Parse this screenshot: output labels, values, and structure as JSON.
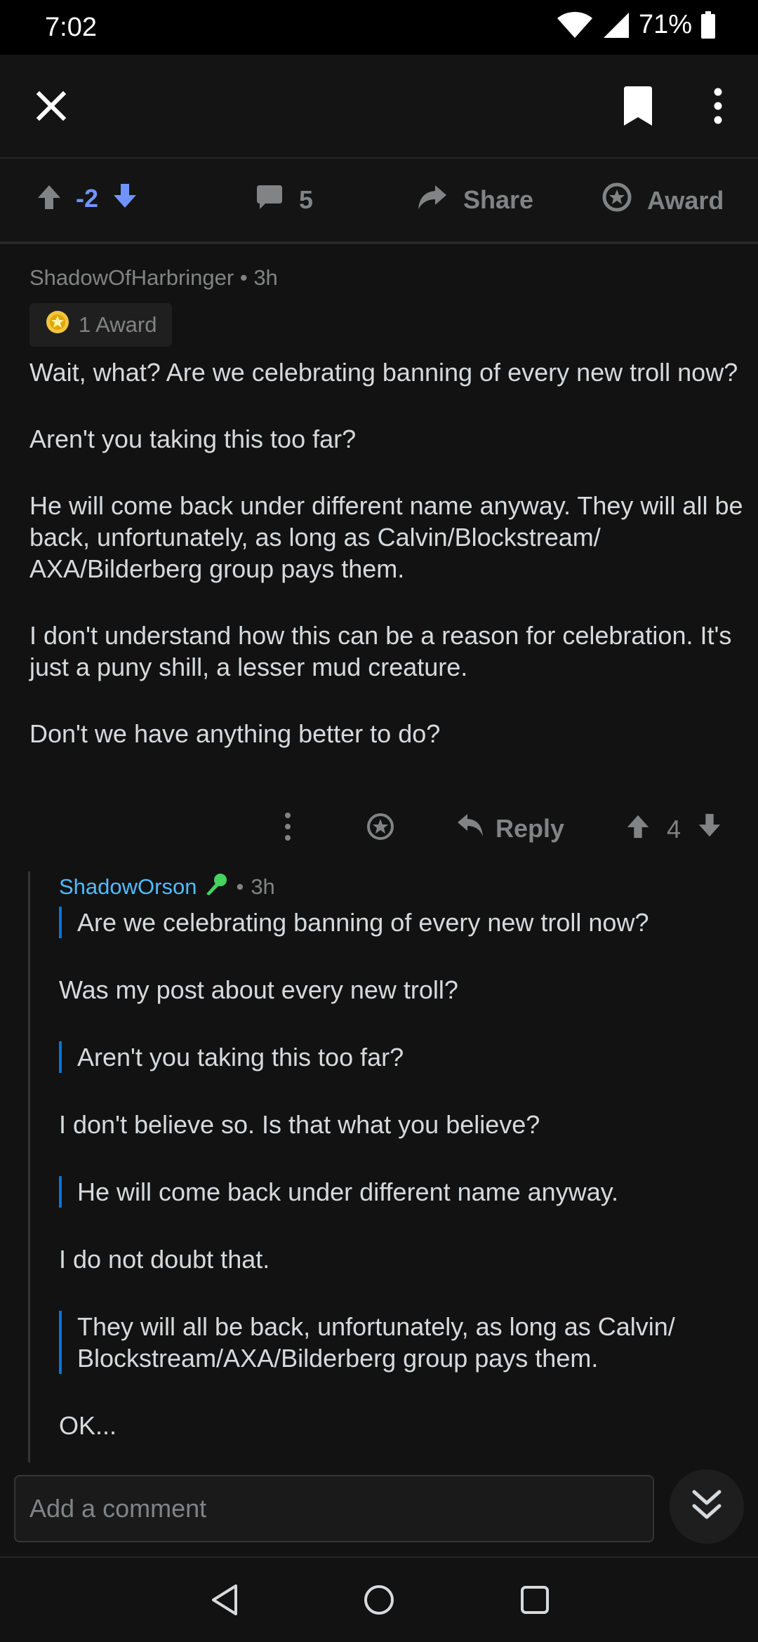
{
  "status_bar": {
    "time": "7:02",
    "battery": "71%"
  },
  "app_bar": {
    "close_icon": "close-icon",
    "bookmark_icon": "bookmark-icon",
    "more_icon": "more-vertical-icon"
  },
  "action_bar": {
    "score": "-2",
    "comments_count": "5",
    "share_label": "Share",
    "award_label": "Award"
  },
  "comment": {
    "author": "ShadowOfHarbringer",
    "time": "3h",
    "meta_sep": "•",
    "award_chip": "1 Award",
    "paragraphs": [
      "Wait, what? Are we celebrating banning of every new troll now?",
      "Aren't you taking this too far?",
      "He will come back under different name anyway. They will all be back, unfortunately, as long as Calvin/Blockstream/ AXA/Bilderberg group pays them.",
      "I don't understand how this can be a reason for celebration. It's just a puny shill, a lesser mud creature.",
      "Don't we have anything better to do?"
    ],
    "reply_label": "Reply",
    "score": "4"
  },
  "reply": {
    "author": "ShadowOrson",
    "time": "3h",
    "meta_sep": "•",
    "blocks": {
      "q1": "Are we celebrating banning of every new troll now?",
      "p1": "Was my post about every new troll?",
      "q2": "Aren't you taking this too far?",
      "p2": "I don't believe so. Is that what you believe?",
      "q3": "He will come back under different name anyway.",
      "p3": "I do not doubt that.",
      "q4": "They will all be back, unfortunately, as long as Calvin/ Blockstream/AXA/Bilderberg group pays them.",
      "p4": "OK..."
    }
  },
  "comment_bar": {
    "placeholder": "Add a comment"
  },
  "colors": {
    "accent_blue": "#7193ff",
    "author_blue": "#4fbcff",
    "quote_bar": "#0079d3",
    "mod_green": "#46d160"
  }
}
